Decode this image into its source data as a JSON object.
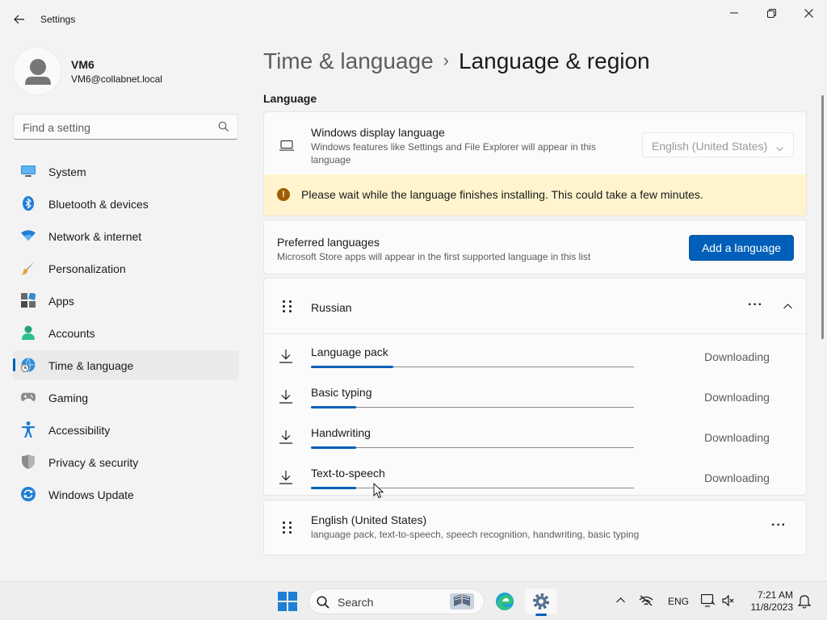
{
  "app": {
    "title": "Settings"
  },
  "user": {
    "name": "VM6",
    "email": "VM6@collabnet.local"
  },
  "search": {
    "placeholder": "Find a setting"
  },
  "nav": {
    "items": [
      {
        "label": "System",
        "icon": "monitor-icon"
      },
      {
        "label": "Bluetooth & devices",
        "icon": "bluetooth-icon"
      },
      {
        "label": "Network & internet",
        "icon": "wifi-icon"
      },
      {
        "label": "Personalization",
        "icon": "brush-icon"
      },
      {
        "label": "Apps",
        "icon": "apps-icon"
      },
      {
        "label": "Accounts",
        "icon": "person-icon"
      },
      {
        "label": "Time & language",
        "icon": "globe-clock-icon",
        "selected": true
      },
      {
        "label": "Gaming",
        "icon": "gamepad-icon"
      },
      {
        "label": "Accessibility",
        "icon": "accessibility-icon"
      },
      {
        "label": "Privacy & security",
        "icon": "shield-icon"
      },
      {
        "label": "Windows Update",
        "icon": "update-icon"
      }
    ]
  },
  "breadcrumb": {
    "parent": "Time & language",
    "separator": "›",
    "current": "Language & region"
  },
  "language_section": {
    "title": "Language"
  },
  "display_language": {
    "title": "Windows display language",
    "subtitle": "Windows features like Settings and File Explorer will appear in this language",
    "value": "English (United States)"
  },
  "warning": {
    "text": "Please wait while the language finishes installing. This could take a few minutes."
  },
  "preferred": {
    "title": "Preferred languages",
    "subtitle": "Microsoft Store apps will appear in the first supported language in this list",
    "button": "Add a language"
  },
  "russian": {
    "name": "Russian",
    "more": "···",
    "features": [
      {
        "label": "Language pack",
        "status": "Downloading",
        "progress": 0.255
      },
      {
        "label": "Basic typing",
        "status": "Downloading",
        "progress": 0.14
      },
      {
        "label": "Handwriting",
        "status": "Downloading",
        "progress": 0.14
      },
      {
        "label": "Text-to-speech",
        "status": "Downloading",
        "progress": 0.14
      }
    ]
  },
  "english": {
    "name": "English (United States)",
    "subtitle": "language pack, text-to-speech, speech recognition, handwriting, basic typing",
    "more": "···"
  },
  "taskbar": {
    "search": "Search",
    "lang": "ENG",
    "time": "7:21 AM",
    "date": "11/8/2023"
  },
  "colors": {
    "accent": "#005fb8",
    "warning_bg": "#fff4ce",
    "warning_icon": "#9d5d00"
  }
}
